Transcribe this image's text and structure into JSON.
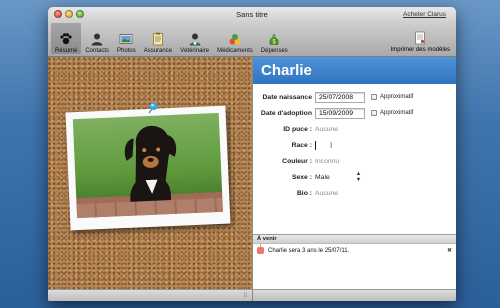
{
  "window": {
    "title": "Sans titre",
    "buy_link": "Acheter Clarus"
  },
  "toolbar": {
    "items": [
      {
        "label": "Résumé",
        "icon": "paw-icon",
        "active": true
      },
      {
        "label": "Contacts",
        "icon": "contacts-icon"
      },
      {
        "label": "Photos",
        "icon": "photos-icon"
      },
      {
        "label": "Assurance",
        "icon": "insurance-icon"
      },
      {
        "label": "Vétérinaire",
        "icon": "vet-icon"
      },
      {
        "label": "Médicaments",
        "icon": "medications-icon"
      },
      {
        "label": "Dépenses",
        "icon": "expenses-icon"
      }
    ],
    "print_label": "Imprimer des modèles"
  },
  "pet": {
    "name": "Charlie",
    "birth_label": "Date naissance",
    "birth_value": "25/07/2008",
    "adoption_label": "Date d'adoption",
    "adoption_value": "15/09/2009",
    "approx_label": "Approximatif",
    "chip_label": "ID puce :",
    "chip_value": "Aucune",
    "breed_label": "Race :",
    "color_label": "Couleur :",
    "color_value": "Inconnu",
    "sex_label": "Sexe :",
    "sex_value": "Male",
    "bio_label": "Bio :",
    "bio_value": "Aucune"
  },
  "upcoming": {
    "title": "À venir",
    "items": [
      {
        "text": "Charlie sera 3 ans le 25/07/11."
      }
    ]
  }
}
